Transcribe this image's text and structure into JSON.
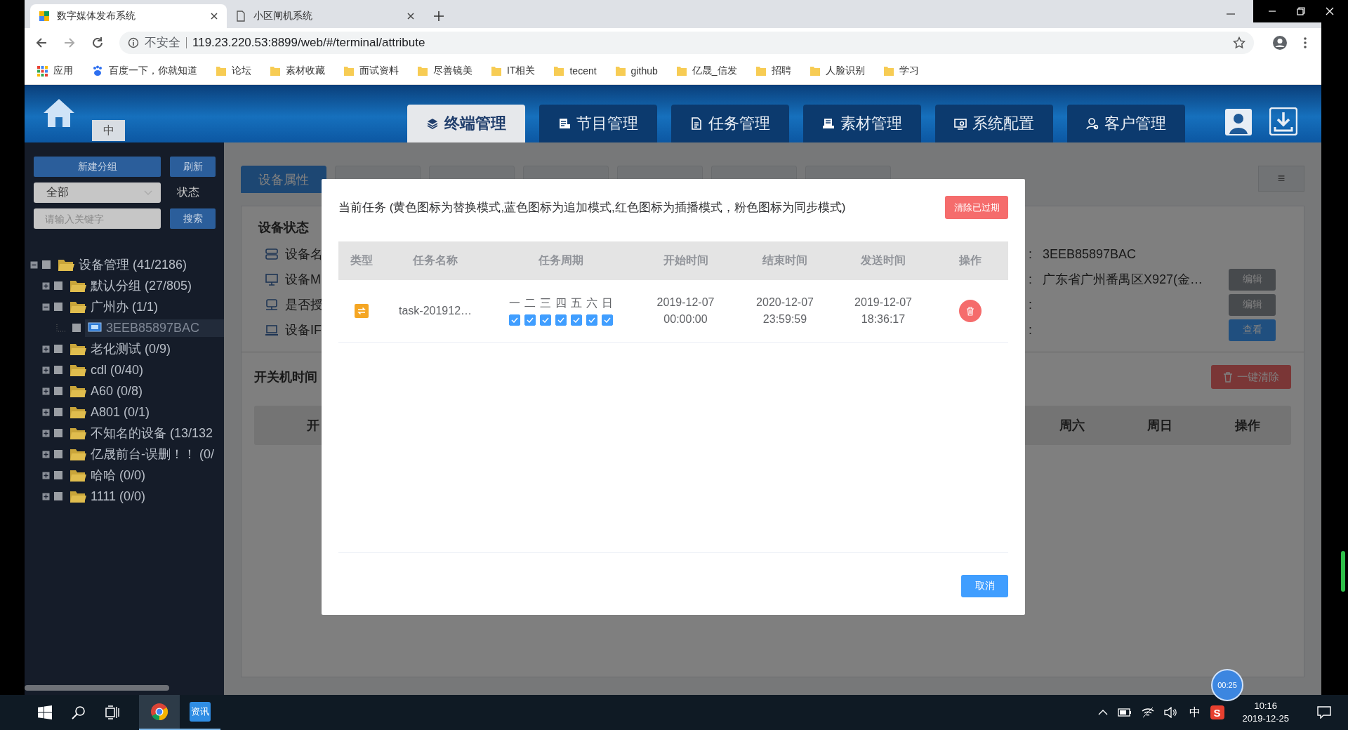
{
  "browser": {
    "tabs": [
      {
        "title": "数字媒体发布系统",
        "selected": true
      },
      {
        "title": "小区闸机系统",
        "selected": false
      }
    ],
    "address": {
      "security": "不安全",
      "url": "119.23.220.53:8899/web/#/terminal/attribute"
    },
    "bookmarks": [
      {
        "label": "应用",
        "kind": "apps"
      },
      {
        "label": "百度一下，你就知道",
        "kind": "site"
      },
      {
        "label": "论坛",
        "kind": "folder"
      },
      {
        "label": "素材收藏",
        "kind": "folder"
      },
      {
        "label": "面试资料",
        "kind": "folder"
      },
      {
        "label": "尽善镜美",
        "kind": "folder"
      },
      {
        "label": "IT相关",
        "kind": "folder"
      },
      {
        "label": "tecent",
        "kind": "folder"
      },
      {
        "label": "github",
        "kind": "folder"
      },
      {
        "label": "亿晟_信发",
        "kind": "folder"
      },
      {
        "label": "招聘",
        "kind": "folder"
      },
      {
        "label": "人脸识别",
        "kind": "folder"
      },
      {
        "label": "学习",
        "kind": "folder"
      }
    ]
  },
  "header": {
    "lang_button": "中",
    "nav": [
      {
        "label": "终端管理",
        "selected": true
      },
      {
        "label": "节目管理",
        "selected": false
      },
      {
        "label": "任务管理",
        "selected": false
      },
      {
        "label": "素材管理",
        "selected": false
      },
      {
        "label": "系统配置",
        "selected": false
      },
      {
        "label": "客户管理",
        "selected": false
      }
    ]
  },
  "sidebar": {
    "new_group_button": "新建分组",
    "refresh_button": "刷新",
    "status_select": {
      "value": "全部"
    },
    "status_label": "状态",
    "search": {
      "placeholder": "请输入关键字"
    },
    "search_button": "搜索",
    "tree": [
      {
        "label": "设备管理 (41/2186)",
        "kind": "folder",
        "expanded": true,
        "checked": false,
        "selected": false,
        "children": [
          {
            "label": "默认分组 (27/805)",
            "kind": "folder",
            "expanded": false,
            "checked": false,
            "selected": false
          },
          {
            "label": "广州办 (1/1)",
            "kind": "folder",
            "expanded": true,
            "checked": false,
            "selected": false,
            "children": [
              {
                "label": "3EEB85897BAC",
                "kind": "device",
                "checked": false,
                "selected": true
              }
            ]
          },
          {
            "label": "老化测试 (0/9)",
            "kind": "folder",
            "expanded": false,
            "checked": false,
            "selected": false
          },
          {
            "label": "cdl (0/40)",
            "kind": "folder",
            "expanded": false,
            "checked": false,
            "selected": false
          },
          {
            "label": "A60 (0/8)",
            "kind": "folder",
            "expanded": false,
            "checked": false,
            "selected": false
          },
          {
            "label": "A801 (0/1)",
            "kind": "folder",
            "expanded": false,
            "checked": false,
            "selected": false
          },
          {
            "label": "不知名的设备 (13/132",
            "kind": "folder",
            "expanded": false,
            "checked": false,
            "selected": false
          },
          {
            "label": "亿晟前台-误删！！ (0/",
            "kind": "folder",
            "expanded": false,
            "checked": false,
            "selected": false
          },
          {
            "label": "哈哈 (0/0)",
            "kind": "folder",
            "expanded": false,
            "checked": false,
            "selected": false
          },
          {
            "label": "1111 (0/0)",
            "kind": "folder",
            "expanded": false,
            "checked": false,
            "selected": false
          }
        ]
      }
    ]
  },
  "main": {
    "tabs": [
      {
        "label": "设备属性",
        "selected": true
      },
      {
        "selected": false
      },
      {
        "selected": false
      },
      {
        "selected": false
      },
      {
        "selected": false
      },
      {
        "selected": false
      },
      {
        "selected": false
      }
    ],
    "menu_button": "≡",
    "device_status": {
      "title": "设备状态",
      "rows": [
        {
          "label": "设备名",
          "colon": ":",
          "value": "3EEB85897BAC"
        },
        {
          "label": "设备M",
          "colon": ":",
          "value": "广东省广州番禺区X927(金…",
          "button": {
            "label": "编辑",
            "kind": "edit"
          }
        },
        {
          "label": "是否授",
          "colon": ":",
          "button": {
            "label": "编辑",
            "kind": "edit"
          }
        },
        {
          "label": "设备IF",
          "colon": ":",
          "button": {
            "label": "查看",
            "kind": "view"
          }
        }
      ]
    },
    "power_schedule": {
      "title": "开关机时间",
      "clear_button": "一键清除",
      "columns": [
        "开",
        "周六",
        "周日",
        "操作"
      ]
    }
  },
  "dialog": {
    "title": "当前任务 (黄色图标为替换模式,蓝色图标为追加模式,红色图标为插播模式，粉色图标为同步模式)",
    "clear_expired_button": "清除已过期",
    "columns": [
      "类型",
      "任务名称",
      "任务周期",
      "开始时间",
      "结束时间",
      "发送时间",
      "操作"
    ],
    "rows": [
      {
        "kind": "replace",
        "name": "task-201912…",
        "weekdays": [
          {
            "label": "一",
            "checked": true
          },
          {
            "label": "二",
            "checked": true
          },
          {
            "label": "三",
            "checked": true
          },
          {
            "label": "四",
            "checked": true
          },
          {
            "label": "五",
            "checked": true
          },
          {
            "label": "六",
            "checked": true
          },
          {
            "label": "日",
            "checked": true
          }
        ],
        "start_date": "2019-12-07",
        "start_time": "00:00:00",
        "end_date": "2020-12-07",
        "end_time": "23:59:59",
        "sent_date": "2019-12-07",
        "sent_time": "18:36:17"
      }
    ],
    "cancel_button": "取消"
  },
  "recording_timer": "00:25",
  "taskbar": {
    "pinned": [
      {
        "kind": "browser",
        "selected": true
      },
      {
        "kind": "app",
        "label": "资讯",
        "selected": false
      }
    ],
    "ime": "中",
    "tray_app_label": "S",
    "time": "10:16",
    "date": "2019-12-25"
  }
}
